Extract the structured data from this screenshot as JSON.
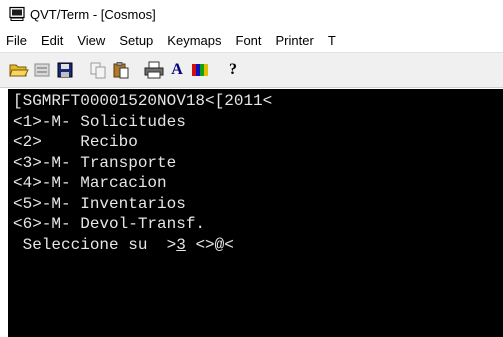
{
  "window": {
    "title": "QVT/Term - [Cosmos]"
  },
  "menu": {
    "items": [
      "File",
      "Edit",
      "View",
      "Setup",
      "Keymaps",
      "Font",
      "Printer",
      "T"
    ]
  },
  "toolbar": {
    "buttons": [
      {
        "icon": "open-folder-icon"
      },
      {
        "icon": "clipboard-icon"
      },
      {
        "icon": "save-icon"
      },
      {
        "icon": "copy-icon"
      },
      {
        "icon": "paste-icon"
      },
      {
        "icon": "print-icon"
      },
      {
        "icon": "font-icon",
        "label": "A"
      },
      {
        "icon": "color-icon"
      },
      {
        "icon": "help-icon",
        "label": "?"
      }
    ]
  },
  "terminal": {
    "lines": [
      "[SGMRFT00001520NOV18<[2011<",
      "<1>-M- Solicitudes",
      "<2>    Recibo",
      "<3>-M- Transporte",
      "<4>-M- Marcacion",
      "<5>-M- Inventarios",
      "<6>-M- Devol-Transf."
    ],
    "prompt_before": " Seleccione su  >",
    "prompt_input": "3",
    "prompt_after": " <>@<"
  },
  "colors": {
    "terminal_bg": "#000000",
    "terminal_fg": "#e6e6e6",
    "toolbar_bg": "#f0f0f0"
  }
}
